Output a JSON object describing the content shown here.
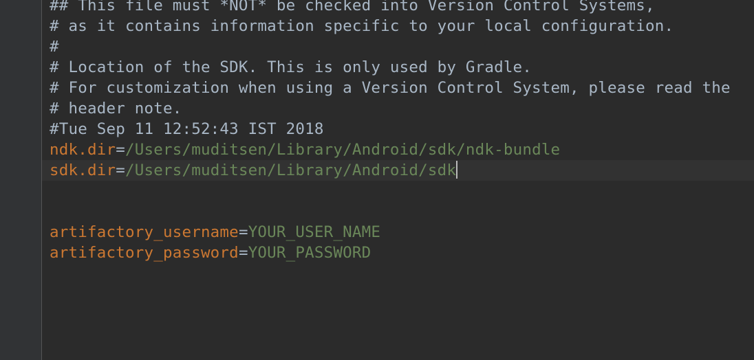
{
  "editor": {
    "lines": [
      {
        "type": "comment",
        "text": "## This file must *NOT* be checked into Version Control Systems,"
      },
      {
        "type": "comment",
        "text": "# as it contains information specific to your local configuration."
      },
      {
        "type": "comment",
        "text": "#"
      },
      {
        "type": "comment",
        "text": "# Location of the SDK. This is only used by Gradle."
      },
      {
        "type": "comment",
        "text": "# For customization when using a Version Control System, please read the"
      },
      {
        "type": "comment",
        "text": "# header note."
      },
      {
        "type": "comment",
        "text": "#Tue Sep 11 12:52:43 IST 2018"
      },
      {
        "type": "property",
        "key": "ndk.dir",
        "sep": "=",
        "value": "/Users/muditsen/Library/Android/sdk/ndk-bundle"
      },
      {
        "type": "property",
        "key": "sdk.dir",
        "sep": "=",
        "value": "/Users/muditsen/Library/Android/sdk"
      },
      {
        "type": "blank",
        "text": ""
      },
      {
        "type": "blank",
        "text": ""
      },
      {
        "type": "property",
        "key": "artifactory_username",
        "sep": "=",
        "value": "YOUR_USER_NAME"
      },
      {
        "type": "property",
        "key": "artifactory_password",
        "sep": "=",
        "value": "YOUR_PASSWORD"
      }
    ]
  },
  "colors": {
    "background": "#2b2b2b",
    "gutter": "#313335",
    "comment": "#a9b7c6",
    "key": "#cc7832",
    "value": "#6a8759",
    "current_line": "#323232"
  }
}
